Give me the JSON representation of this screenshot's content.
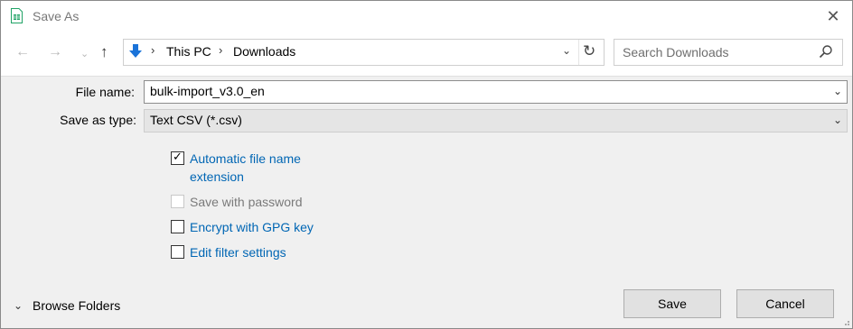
{
  "window": {
    "title": "Save As"
  },
  "nav": {
    "back": "←",
    "forward": "→",
    "recent": "⌄",
    "up": "↑"
  },
  "address": {
    "crumbs": [
      "This PC",
      "Downloads"
    ],
    "separator": "›",
    "dropdown": "⌄",
    "refresh": "↻",
    "icon": "downloads-arrow-icon"
  },
  "search": {
    "placeholder": "Search Downloads",
    "icon": "search-icon"
  },
  "form": {
    "file_name_label": "File name:",
    "file_name_value": "bulk-import_v3.0_en",
    "save_type_label": "Save as type:",
    "save_type_value": "Text CSV (*.csv)",
    "dropdown_arrow": "⌄"
  },
  "options": [
    {
      "label_line1": "Automatic file name",
      "label_line2": "extension",
      "checked": true,
      "enabled": true
    },
    {
      "label": "Save with password",
      "checked": false,
      "enabled": false
    },
    {
      "label": "Encrypt with GPG key",
      "checked": false,
      "enabled": true
    },
    {
      "label": "Edit filter settings",
      "checked": false,
      "enabled": true
    }
  ],
  "check_mark": "✓",
  "footer": {
    "browse_label": "Browse Folders",
    "browse_chevron": "⌄",
    "save_button": "Save",
    "cancel_button": "Cancel"
  },
  "colors": {
    "link": "#0066b4",
    "accent_icon": "#1a73d9",
    "sheet_green": "#21a366"
  }
}
